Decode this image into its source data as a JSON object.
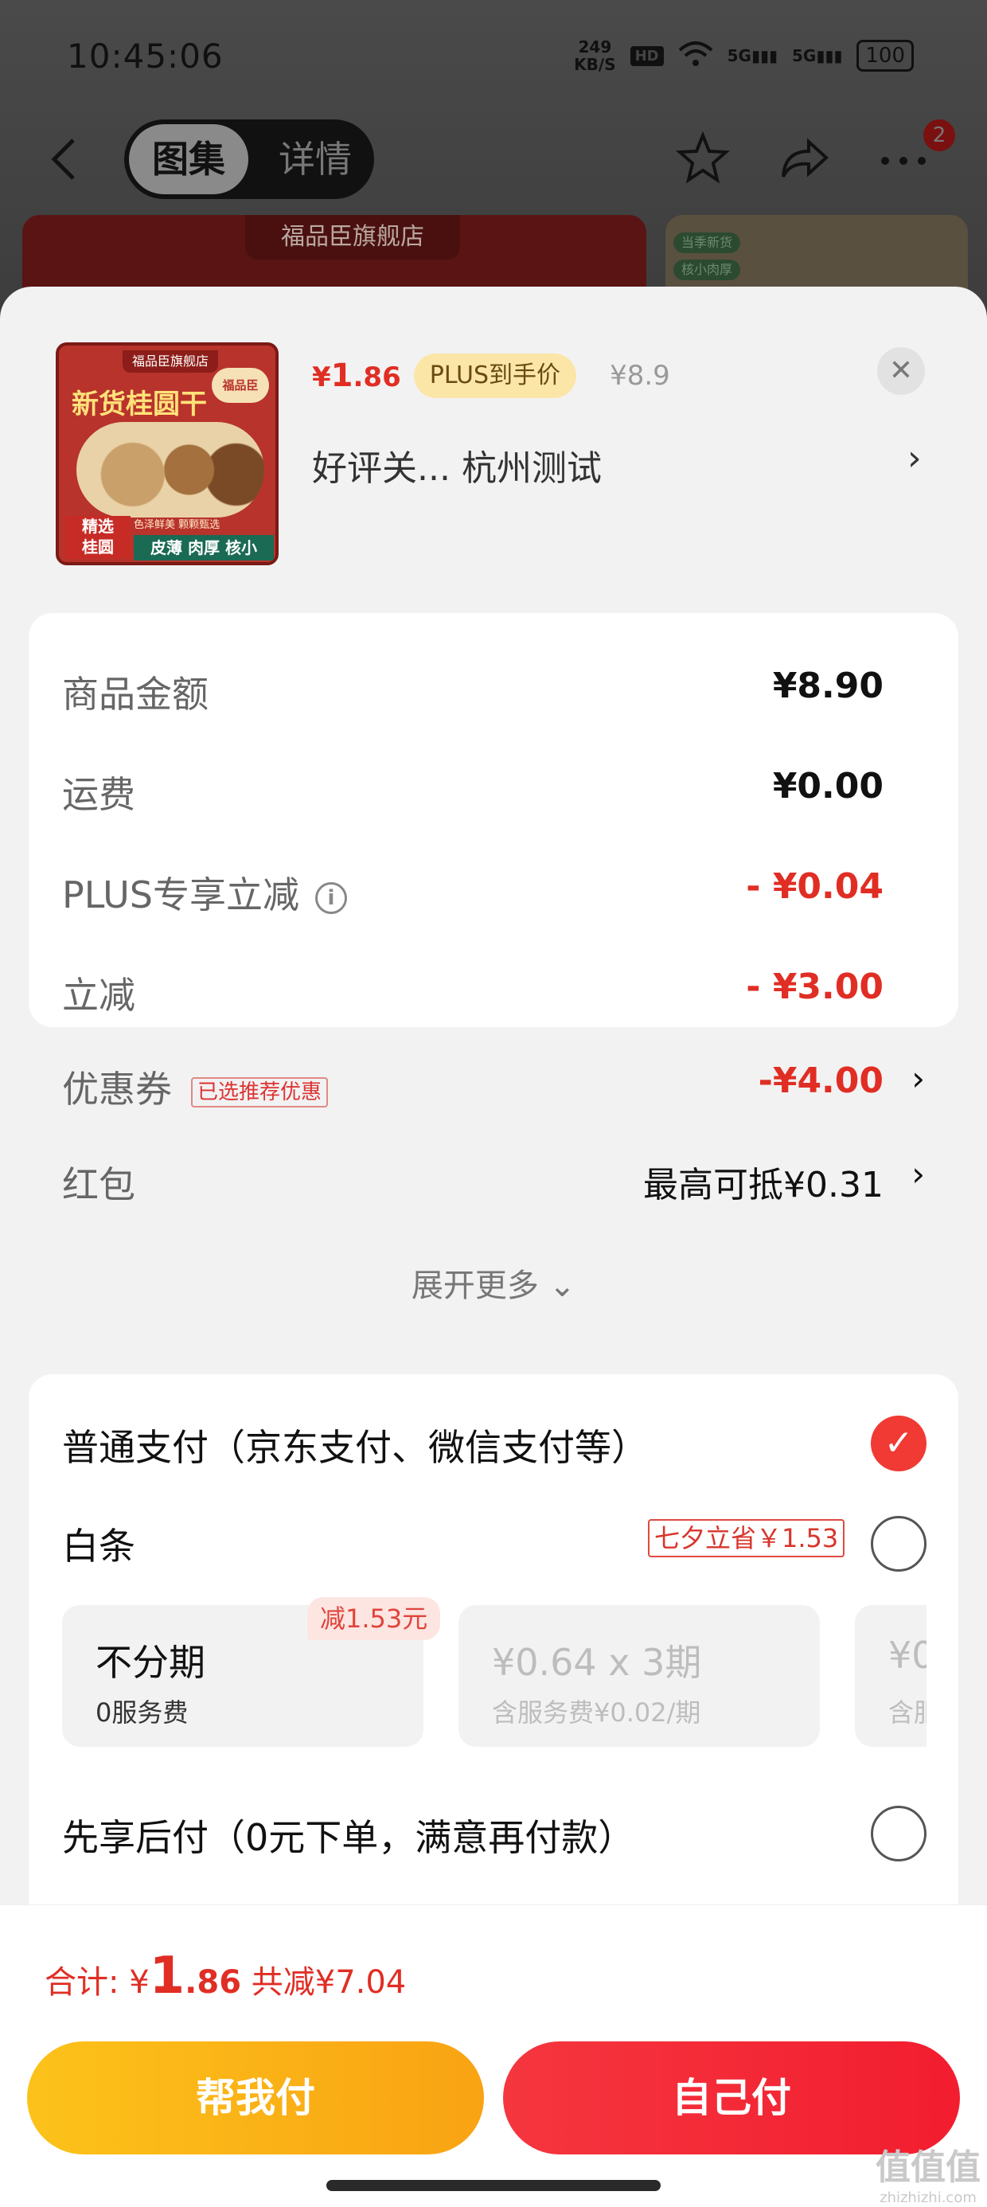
{
  "status_bar": {
    "time": "10:45:06",
    "net_speed_value": "249",
    "net_speed_unit": "KB/S",
    "hd_label": "HD",
    "signal1_label": "5G",
    "signal2_label": "5G",
    "battery": "100"
  },
  "top_nav": {
    "tab_gallery": "图集",
    "tab_detail": "详情",
    "notification_count": "2",
    "icons": [
      "back-arrow-icon",
      "star-icon",
      "share-icon",
      "more-icon"
    ]
  },
  "background_banner": {
    "store_tab": "福品臣旗舰店",
    "tag_1": "当季新货",
    "tag_2": "核小肉厚"
  },
  "product": {
    "image": {
      "store_label": "福品臣旗舰店",
      "brand_label": "福品臣",
      "title": "新货桂圆干",
      "badge": "精选\n桂圆",
      "fresh_text": "色泽鲜美 颗颗甄选",
      "features": "皮薄 肉厚 核小"
    },
    "price_yen": "¥",
    "price_int": "1",
    "price_dec": ".86",
    "plus_badge": "PLUS到手价",
    "original_price": "¥8.9",
    "spec_text": "好评关...  杭州测试"
  },
  "amount_card": {
    "rows": [
      {
        "label": "商品金额",
        "value": "¥8.90"
      },
      {
        "label": "运费",
        "value": "¥0.00"
      },
      {
        "label": "PLUS专享立减",
        "value": "- ¥0.04"
      },
      {
        "label": "立减",
        "value": "- ¥3.00"
      },
      {
        "label": "优惠券",
        "tag": "已选推荐优惠",
        "value": "-¥4.00"
      },
      {
        "label": "红包",
        "value": "最高可抵¥0.31"
      }
    ],
    "expand_more": "展开更多"
  },
  "payment": {
    "normal_pay": "普通支付（京东支付、微信支付等）",
    "baitiao": "白条",
    "baitiao_promo": "七夕立省￥1.53",
    "plans": [
      {
        "title": "不分期",
        "sub": "0服务费",
        "badge": "减1.53元"
      },
      {
        "title": "¥0.64 x 3期",
        "sub": "含服务费¥0.02/期"
      },
      {
        "title": "¥0",
        "sub": "含服"
      }
    ],
    "pay_later": "先享后付（0元下单，满意再付款）"
  },
  "total": {
    "label": "合计: ¥",
    "int": "1",
    "dec": ".86",
    "saved": " 共减¥7.04"
  },
  "buttons": {
    "help_pay": "帮我付",
    "self_pay": "自己付"
  },
  "watermark": {
    "title": "值值值",
    "url": "zhizhizhi.com"
  },
  "colors": {
    "accent_red": "#e02e24",
    "plus_gold": "#fbe6a8",
    "help_btn": "#fcc21a",
    "self_btn": "#f21d2f"
  }
}
